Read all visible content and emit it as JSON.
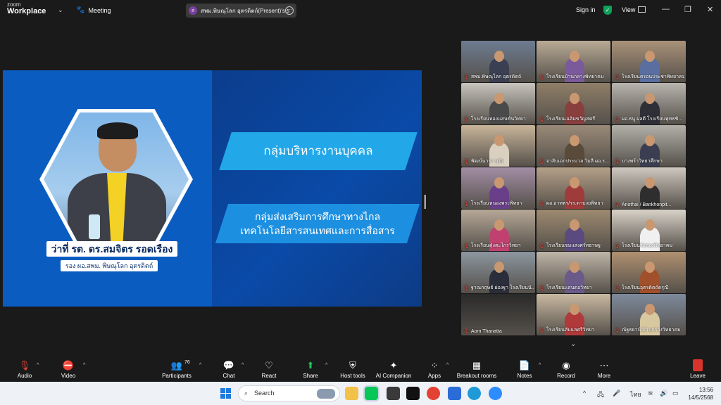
{
  "topbar": {
    "brand_small": "zoom",
    "brand_large": "Workplace",
    "meeting_label": "Meeting",
    "presenter_initial": "ส",
    "presenter_label": "สพม.พิษณุโลก อุตรดิตถ์(Present)'s s",
    "signin_label": "Sign in",
    "view_label": "View"
  },
  "share": {
    "speaker_name": "ว่าที่ รต. ดร.สมจิตร รอดเรือง",
    "speaker_title": "รอง ผอ.สพม. พิษณุโลก อุตรดิตถ์",
    "banner1": "กลุ่มบริหารงานบุคคล",
    "banner2_line1": "กลุ่มส่งเสริมการศึกษาทางไกล",
    "banner2_line2": "เทคโนโลยีสารสนเทศและการสื่อสาร"
  },
  "gallery": {
    "tiles": [
      {
        "name": "สพม.พิษณุโลก อุตรดิตถ์",
        "active": true,
        "bg": "#6d7c92",
        "shirt": "#3a3f52"
      },
      {
        "name": "โรงเรียนบ้านกลางพิทยาคม",
        "active": false,
        "bg": "#b9aa95",
        "shirt": "#7a5a9a"
      },
      {
        "name": "โรงเรียนตรอนประชาพิทยาคม",
        "active": false,
        "bg": "#a99278",
        "shirt": "#5a6fa0"
      },
      {
        "name": "โรงเรียนทองแสนขันวิทยา",
        "active": false,
        "bg": "#c8c4be",
        "shirt": "#4a4a4a"
      },
      {
        "name": "โรงเรียนเฉลิมขวัญสตรี",
        "active": false,
        "bg": "#8f7e68",
        "shirt": "#8a3f3f"
      },
      {
        "name": "ผอ.ธนู ผลดี โรงเรียนพุทธชิ...",
        "active": false,
        "bg": "#b8b4ae",
        "shirt": "#2f2f38"
      },
      {
        "name": "พัฒน์นารา นุปิง",
        "active": false,
        "bg": "#c9b59a",
        "shirt": "#d9d0c0"
      },
      {
        "name": "จาสิบเอกประมวล วิมลี ผอ.ร...",
        "active": false,
        "bg": "#9a8a78",
        "shirt": "#5a4a3a"
      },
      {
        "name": "บางพร้าวิทยาศึกษา",
        "active": false,
        "bg": "#b3b0aa",
        "shirt": "#3a3e50"
      },
      {
        "name": "โรงเรียนหนองพระพิทยา",
        "active": false,
        "bg": "#a38ea5",
        "shirt": "#6a3f8a"
      },
      {
        "name": "ผอ.อาทพร/รร.ดาบงยพิทยา",
        "active": false,
        "bg": "#b59f88",
        "shirt": "#a03b3b"
      },
      {
        "name": "Anothai / Bankhonpit...",
        "active": false,
        "bg": "#cfc8c0",
        "shirt": "#2e2e2e"
      },
      {
        "name": "โรงเรียนคุ้งตะไกรวิทยา",
        "active": false,
        "bg": "#b7a898",
        "shirt": "#c04070"
      },
      {
        "name": "โรงเรียนชมแสงศรัทธาษฐ",
        "active": false,
        "bg": "#9d8a70",
        "shirt": "#5a4a80"
      },
      {
        "name": "โรงเรียนวังทองพิทยาคม",
        "active": false,
        "bg": "#d8d2c8",
        "shirt": "#f0f0f0"
      },
      {
        "name": "ฐาณกฤษธ์ ผ่องฐา โรงเรียนน้...",
        "active": false,
        "bg": "#8c96a0",
        "shirt": "#2a2e3a"
      },
      {
        "name": "โรงเรียนแสนตอวิทยา",
        "active": false,
        "bg": "#bfb5a8",
        "shirt": "#6a5a8a"
      },
      {
        "name": "โรงเรียนอุตรดิตถ์ดรุณี",
        "active": false,
        "bg": "#b09070",
        "shirt": "#a0502a"
      },
      {
        "name": "Aom Thanatta",
        "active": false,
        "bg": "#2a2a2a",
        "shirt": "#2a2a2a"
      },
      {
        "name": "โรงเรียนลับแลศรีวิทยา",
        "active": false,
        "bg": "#c9b9a2",
        "shirt": "#b03a3a"
      },
      {
        "name": "ณัฐธยาน์ บ้านกร่างวิทยาคม",
        "active": false,
        "bg": "#7e8a9c",
        "shirt": "#d8c8a0"
      }
    ]
  },
  "toolbar": {
    "audio": "Audio",
    "video": "Video",
    "participants": "Participants",
    "participants_count": "76",
    "chat": "Chat",
    "react": "React",
    "share": "Share",
    "host_tools": "Host tools",
    "ai_companion": "AI Companion",
    "apps": "Apps",
    "breakout_rooms": "Breakout rooms",
    "notes": "Notes",
    "record": "Record",
    "more": "More",
    "leave": "Leave"
  },
  "taskbar": {
    "search_placeholder": "Search",
    "lang": "ไทย",
    "time": "13:56",
    "date": "14/5/2568"
  }
}
